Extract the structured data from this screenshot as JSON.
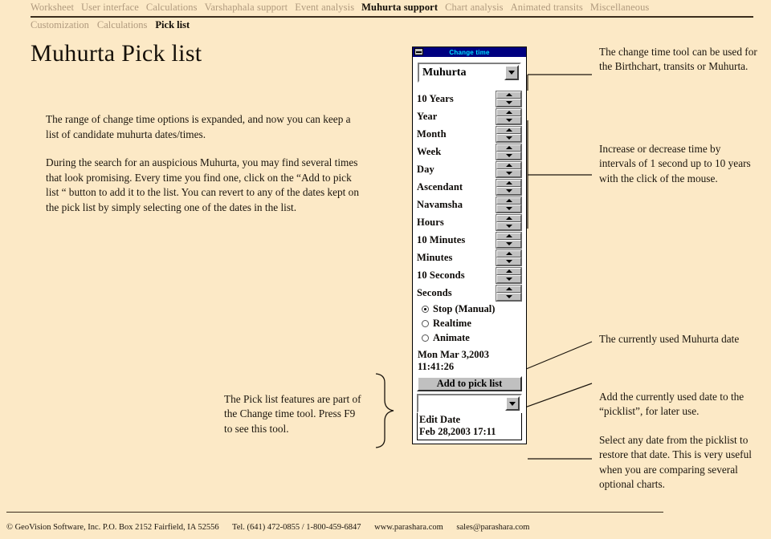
{
  "nav": {
    "primary": [
      {
        "label": "Worksheet",
        "active": false
      },
      {
        "label": "User interface",
        "active": false
      },
      {
        "label": "Calculations",
        "active": false
      },
      {
        "label": "Varshaphala support",
        "active": false
      },
      {
        "label": "Event analysis",
        "active": false
      },
      {
        "label": "Muhurta support",
        "active": true
      },
      {
        "label": "Chart analysis",
        "active": false
      },
      {
        "label": "Animated transits",
        "active": false
      },
      {
        "label": "Miscellaneous",
        "active": false
      }
    ],
    "secondary": [
      {
        "label": "Customization",
        "active": false
      },
      {
        "label": "Calculations",
        "active": false
      },
      {
        "label": "Pick list",
        "active": true
      }
    ]
  },
  "page": {
    "title": "Muhurta Pick list",
    "intro_paragraph_1": "The range of change time options is expanded, and now you can keep a list of candidate muhurta dates/times.",
    "intro_paragraph_2": "During the search for an auspicious Muhurta, you may find several times that look promising. Every time you find one, click on the “Add to pick list “ button to add it to the list.   You can revert to any of the dates kept on the pick list by simply selecting one of the dates in the list."
  },
  "dialog": {
    "title": "Change time",
    "mode_combo_value": "Muhurta",
    "spinners": [
      {
        "label": "10 Years"
      },
      {
        "label": "Year"
      },
      {
        "label": "Month"
      },
      {
        "label": "Week"
      },
      {
        "label": "Day"
      },
      {
        "label": "Ascendant"
      },
      {
        "label": "Navamsha"
      },
      {
        "label": "Hours"
      },
      {
        "label": "10 Minutes"
      },
      {
        "label": "Minutes"
      },
      {
        "label": "10 Seconds"
      },
      {
        "label": "Seconds"
      }
    ],
    "radios": [
      {
        "label": "Stop (Manual)",
        "selected": true
      },
      {
        "label": "Realtime",
        "selected": false
      },
      {
        "label": "Animate",
        "selected": false
      }
    ],
    "current_date": "Mon Mar 3,2003",
    "current_time": "11:41:26",
    "add_button_label": "Add to pick list",
    "picklist_combo_value": "",
    "picklist_items": [
      {
        "label": "Edit Date"
      },
      {
        "label": "Feb 28,2003  17:11"
      }
    ]
  },
  "annotations": {
    "change_time_tool": "The change time tool can be used for the Birthchart, transits or Muhurta.",
    "increase_decrease": "Increase or decrease time by intervals of 1 second up to 10 years with the click of the mouse.",
    "currently_used_date": "The currently used Muhurta date",
    "add_currently_used": "Add the currently used date to the “picklist”, for later use.",
    "select_any_date": "Select any date from the picklist to restore that date. This is very useful when you are comparing several optional charts.",
    "pick_list_features": "The Pick list features are part of the Change time tool. Press F9 to see this tool."
  },
  "footer": {
    "copyright": "© GeoVision Software, Inc. P.O. Box 2152 Fairfield, IA 52556",
    "phone": "Tel. (641) 472-0855 / 1-800-459-6847",
    "website": "www.parashara.com",
    "email": "sales@parashara.com"
  },
  "colors": {
    "page_background": "#fce9c6",
    "titlebar": "#000080",
    "titlebar_text": "#00e0ff",
    "nav_inactive": "#b09a7e",
    "nav_active": "#120d06",
    "control_face": "#c0c0c0"
  }
}
